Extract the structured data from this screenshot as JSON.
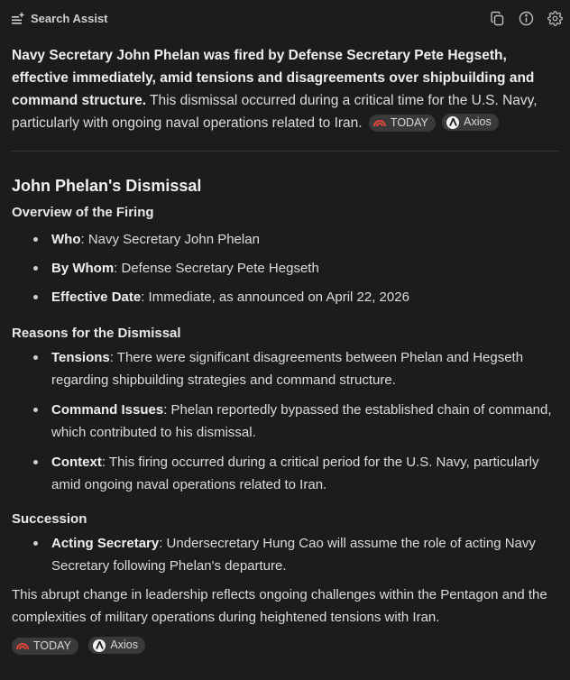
{
  "header": {
    "title": "Search Assist",
    "icons": [
      "sparkle-list-icon",
      "copy-icon",
      "info-icon",
      "gear-icon"
    ]
  },
  "summary": {
    "bold": "Navy Secretary John Phelan was fired by Defense Secretary Pete Hegseth, effective immediately, amid tensions and disagreements over shipbuilding and command structure.",
    "text": " This dismissal occurred during a critical time for the U.S. Navy, particularly with ongoing naval operations related to Iran.",
    "sources": [
      "TODAY",
      "Axios"
    ]
  },
  "article": {
    "title": "John Phelan's Dismissal",
    "overview": {
      "heading": "Overview of the Firing",
      "items": [
        {
          "label": "Who",
          "text": ": Navy Secretary John Phelan"
        },
        {
          "label": "By Whom",
          "text": ": Defense Secretary Pete Hegseth"
        },
        {
          "label": "Effective Date",
          "text": ": Immediate, as announced on April 22, 2026"
        }
      ]
    },
    "reasons": {
      "heading": "Reasons for the Dismissal",
      "items": [
        {
          "label": "Tensions",
          "text": ": There were significant disagreements between Phelan and Hegseth regarding shipbuilding strategies and command structure."
        },
        {
          "label": "Command Issues",
          "text": ": Phelan reportedly bypassed the established chain of command, which contributed to his dismissal."
        },
        {
          "label": "Context",
          "text": ": This firing occurred during a critical period for the U.S. Navy, particularly amid ongoing naval operations related to Iran."
        }
      ]
    },
    "succession": {
      "heading": "Succession",
      "items": [
        {
          "label": "Acting Secretary",
          "text": ": Undersecretary Hung Cao will assume the role of acting Navy Secretary following Phelan's departure."
        }
      ]
    },
    "closing": "This abrupt change in leadership reflects ongoing challenges within the Pentagon and the complexities of military operations during heightened tensions with Iran.",
    "sources": [
      "TODAY",
      "Axios"
    ]
  },
  "colors": {
    "background": "#1c1c1c",
    "chip": "#3a3a3a",
    "today_accent": "#e0453a"
  }
}
